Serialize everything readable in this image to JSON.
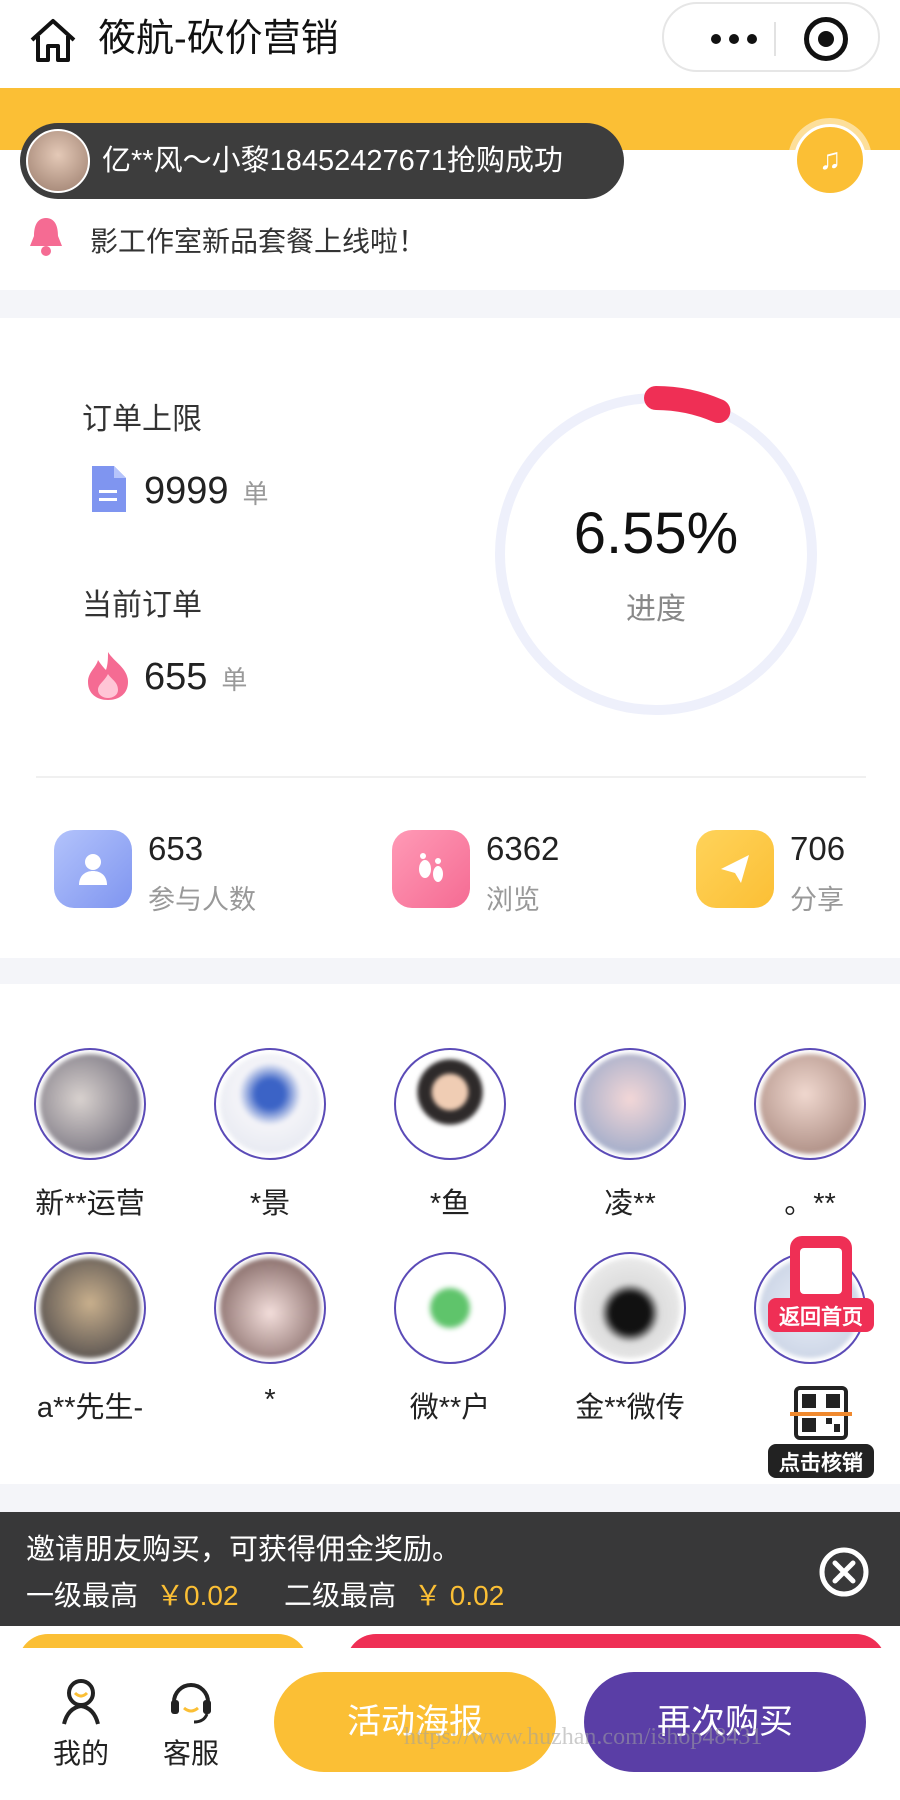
{
  "header": {
    "title": "筱航-砍价营销",
    "home_icon": "home-icon",
    "more_icon": "more-dots-icon",
    "close_icon": "target-icon"
  },
  "toast": {
    "text": "亿**风～小黎18452427671抢购成功"
  },
  "notice": {
    "text": "影工作室新品套餐上线啦！",
    "icon": "bell-icon"
  },
  "stats": {
    "order_limit_label": "订单上限",
    "order_limit_value": "9999",
    "order_limit_unit": "单",
    "current_orders_label": "当前订单",
    "current_orders_value": "655",
    "current_orders_unit": "单",
    "progress_value": "6.55%",
    "progress_label": "进度",
    "progress_fraction": 0.0655,
    "metrics": [
      {
        "value": "653",
        "label": "参与人数",
        "icon": "person-icon",
        "color": "#8fa6f6"
      },
      {
        "value": "6362",
        "label": "浏览",
        "icon": "footprint-icon",
        "color": "#f56b93"
      },
      {
        "value": "706",
        "label": "分享",
        "icon": "share-arrow-icon",
        "color": "#fbbf35"
      }
    ]
  },
  "participants": [
    {
      "name": "新**运营"
    },
    {
      "name": "*景"
    },
    {
      "name": "*鱼"
    },
    {
      "name": "凌**"
    },
    {
      "name": "。**"
    },
    {
      "name": "a**先生-"
    },
    {
      "name": "*"
    },
    {
      "name": "微**户"
    },
    {
      "name": "金**微传"
    },
    {
      "name": ""
    }
  ],
  "floating": {
    "back_home_label": "返回首页",
    "scan_label": "点击核销"
  },
  "commission": {
    "title": "邀请朋友购买，可获得佣金奖励。",
    "level1_label": "一级最高",
    "level1_value": "￥0.02",
    "level2_label": "二级最高",
    "level2_value": "￥ 0.02"
  },
  "bottom_bar": {
    "mine_label": "我的",
    "service_label": "客服",
    "poster_label": "活动海报",
    "rebuy_label": "再次购买"
  },
  "watermark": "https://www.huzhan.com/ishop48431",
  "colors": {
    "accent_yellow": "#fbbf35",
    "accent_purple": "#5a3ea6",
    "progress_red": "#ef2f55"
  }
}
